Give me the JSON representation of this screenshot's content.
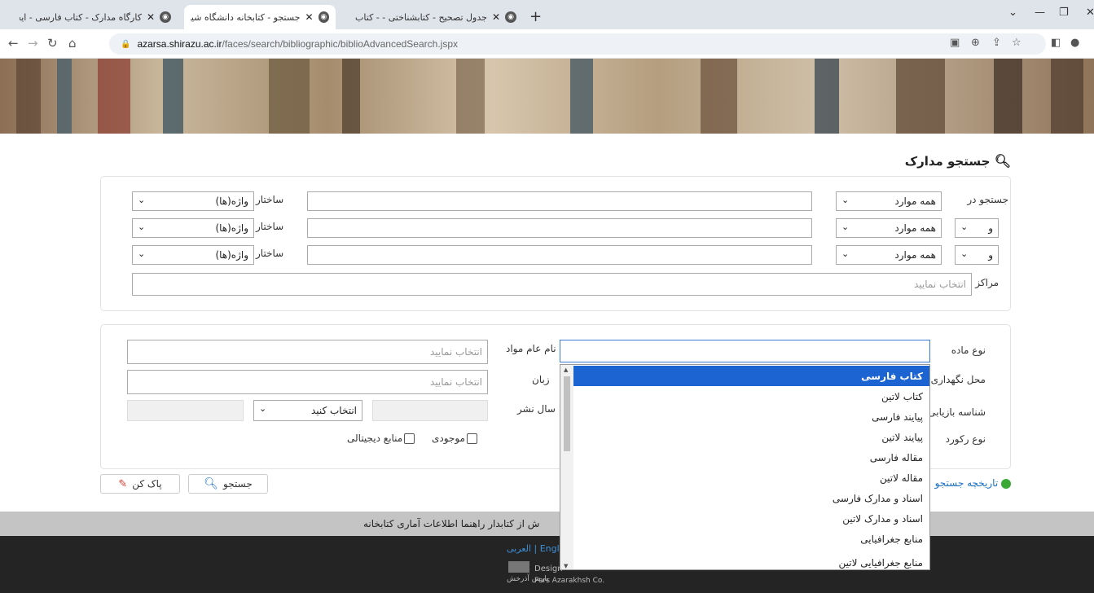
{
  "browser": {
    "tabs": [
      {
        "title": "کارگاه مدارک - کتاب فارسی - ایجاد",
        "active": false
      },
      {
        "title": "جستجو - کتابخانه دانشگاه شیراز",
        "active": true
      },
      {
        "title": "جدول تصحیح - کتابشناختی - - کتاب",
        "active": false
      }
    ],
    "new_tab": "+",
    "url_domain": "azarsa.shirazu.ac.ir",
    "url_path": "/faces/search/bibliographic/biblioAdvancedSearch.jspx"
  },
  "page": {
    "title": "جستجو مدارک",
    "search_rows": [
      {
        "prefix": "جستجو در",
        "field": "همه موارد",
        "structure_label": "ساختار",
        "structure": "واژه(ها)"
      },
      {
        "prefix": "و",
        "field": "همه موارد",
        "structure_label": "ساختار",
        "structure": "واژه(ها)"
      },
      {
        "prefix": "و",
        "field": "همه موارد",
        "structure_label": "ساختار",
        "structure": "واژه(ها)"
      }
    ],
    "centers_label": "مراکز",
    "centers_placeholder": "انتخاب نمایید",
    "filters": {
      "material_type_label": "نوع ماده",
      "location_label": "محل نگهداری",
      "retrieval_id_label": "شناسه بازیابی",
      "record_type_label": "نوع رکورد",
      "material_name_label": "نام عام مواد",
      "material_name_placeholder": "انتخاب نمایید",
      "language_label": "زبان",
      "language_placeholder": "انتخاب نمایید",
      "pub_year_label": "سال نشر",
      "pub_year_select": "انتخاب کنید",
      "available_label": "موجودی",
      "digital_label": "منابع دیجیتالی"
    },
    "history_link": "تاریخچه جستجو",
    "search_button": "جستجو",
    "clear_button": "پاک کن",
    "footer_links": "ش از کتابدار   راهنما   اطلاعات آماری کتابخانه",
    "footer_lang": "العربی | Engl",
    "footer_design": "Design",
    "footer_company": "Pars Azarakhsh Co.",
    "footer_company_fa": "پارس آذرخش"
  },
  "dropdown": {
    "options": [
      "کتاب فارسی",
      "کتاب لاتین",
      "پیایند فارسی",
      "پیایند لاتین",
      "مقاله فارسی",
      "مقاله لاتین",
      "اسناد و مدارک فارسی",
      "اسناد و مدارک لاتین",
      "منابع جغرافیایی",
      "منابع جغرافیایی لاتین"
    ],
    "selected_index": 0
  },
  "colors": {
    "selected": "#1c64d1",
    "focus_border": "#3c7bd6",
    "footer_dark": "#242424",
    "footer_light": "#c4c4c4"
  }
}
